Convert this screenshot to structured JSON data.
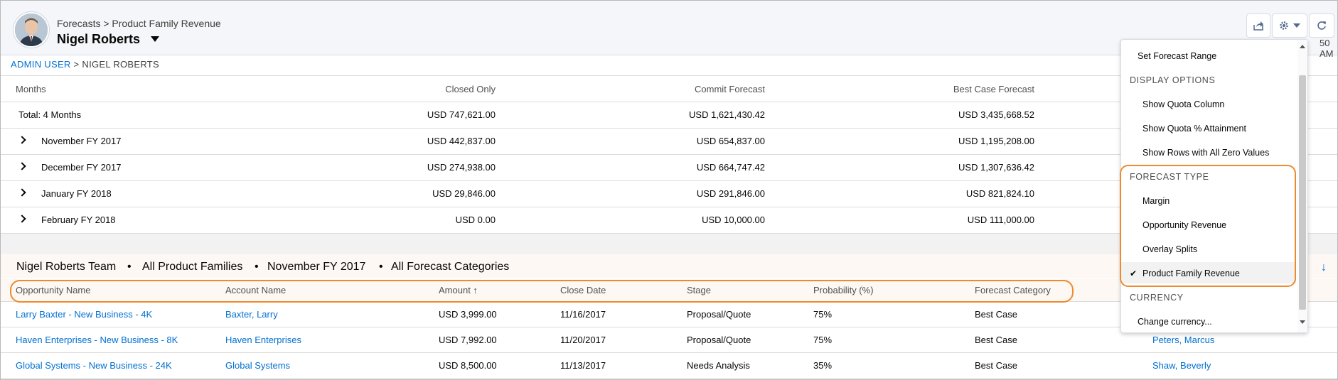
{
  "header": {
    "breadcrumb": "Forecasts > Product Family Revenue",
    "owner_name": "Nigel Roberts",
    "time_fragment": "50 AM",
    "icons": [
      "share-icon",
      "gear-icon",
      "chevron-down-icon",
      "refresh-icon"
    ]
  },
  "user_path": {
    "root": "ADMIN USER",
    "sep": ">",
    "current": "NIGEL ROBERTS"
  },
  "forecast_table": {
    "headers": [
      "Months",
      "Closed Only",
      "Commit Forecast",
      "Best Case Forecast"
    ],
    "rows": [
      {
        "label": "Total: 4 Months",
        "closed": "USD 747,621.00",
        "commit": "USD 1,621,430.42",
        "best": "USD 3,435,668.52"
      },
      {
        "label": "November FY 2017",
        "closed": "USD 442,837.00",
        "commit": "USD 654,837.00",
        "best": "USD 1,195,208.00"
      },
      {
        "label": "December FY 2017",
        "closed": "USD 274,938.00",
        "commit": "USD 664,747.42",
        "best": "USD 1,307,636.42"
      },
      {
        "label": "January FY 2018",
        "closed": "USD 29,846.00",
        "commit": "USD 291,846.00",
        "best": "USD 821,824.10"
      },
      {
        "label": "February FY 2018",
        "closed": "USD 0.00",
        "commit": "USD 10,000.00",
        "best": "USD 111,000.00"
      }
    ]
  },
  "filter_bar": {
    "team": "Nigel Roberts Team",
    "families": "All Product Families",
    "period": "November FY 2017",
    "categories": "All Forecast Categories",
    "dot": "•"
  },
  "detail_table": {
    "headers": [
      "Opportunity Name",
      "Account Name",
      "Amount ↑",
      "Close Date",
      "Stage",
      "Probability (%)",
      "Forecast Category"
    ],
    "rows": [
      {
        "opp": "Larry Baxter - New Business - 4K",
        "account": "Baxter, Larry",
        "amount": "USD 3,999.00",
        "date": "11/16/2017",
        "stage": "Proposal/Quote",
        "prob": "75%",
        "cat": "Best Case",
        "owner": ""
      },
      {
        "opp": "Haven Enterprises - New Business - 8K",
        "account": "Haven Enterprises",
        "amount": "USD 7,992.00",
        "date": "11/20/2017",
        "stage": "Proposal/Quote",
        "prob": "75%",
        "cat": "Best Case",
        "owner": "Peters, Marcus"
      },
      {
        "opp": "Global Systems - New Business - 24K",
        "account": "Global Systems",
        "amount": "USD 8,500.00",
        "date": "11/13/2017",
        "stage": "Needs Analysis",
        "prob": "35%",
        "cat": "Best Case",
        "owner": "Shaw, Beverly"
      }
    ]
  },
  "menu": {
    "items": [
      {
        "kind": "item",
        "label": "Set Forecast Range"
      },
      {
        "kind": "section",
        "label": "DISPLAY OPTIONS"
      },
      {
        "kind": "item",
        "label": "Show Quota Column"
      },
      {
        "kind": "item",
        "label": "Show Quota % Attainment"
      },
      {
        "kind": "item",
        "label": "Show Rows with All Zero Values"
      },
      {
        "kind": "section",
        "label": "FORECAST TYPE"
      },
      {
        "kind": "item",
        "label": "Margin"
      },
      {
        "kind": "item",
        "label": "Opportunity Revenue"
      },
      {
        "kind": "item",
        "label": "Overlay Splits"
      },
      {
        "kind": "item",
        "label": "Product Family Revenue",
        "selected": true
      },
      {
        "kind": "section",
        "label": "CURRENCY"
      },
      {
        "kind": "item",
        "label": "Change currency..."
      }
    ],
    "check_glyph": "✔"
  },
  "colors": {
    "link": "#0070d2",
    "highlight": "#ee8a2c",
    "header_bg": "#f4f6f9"
  }
}
